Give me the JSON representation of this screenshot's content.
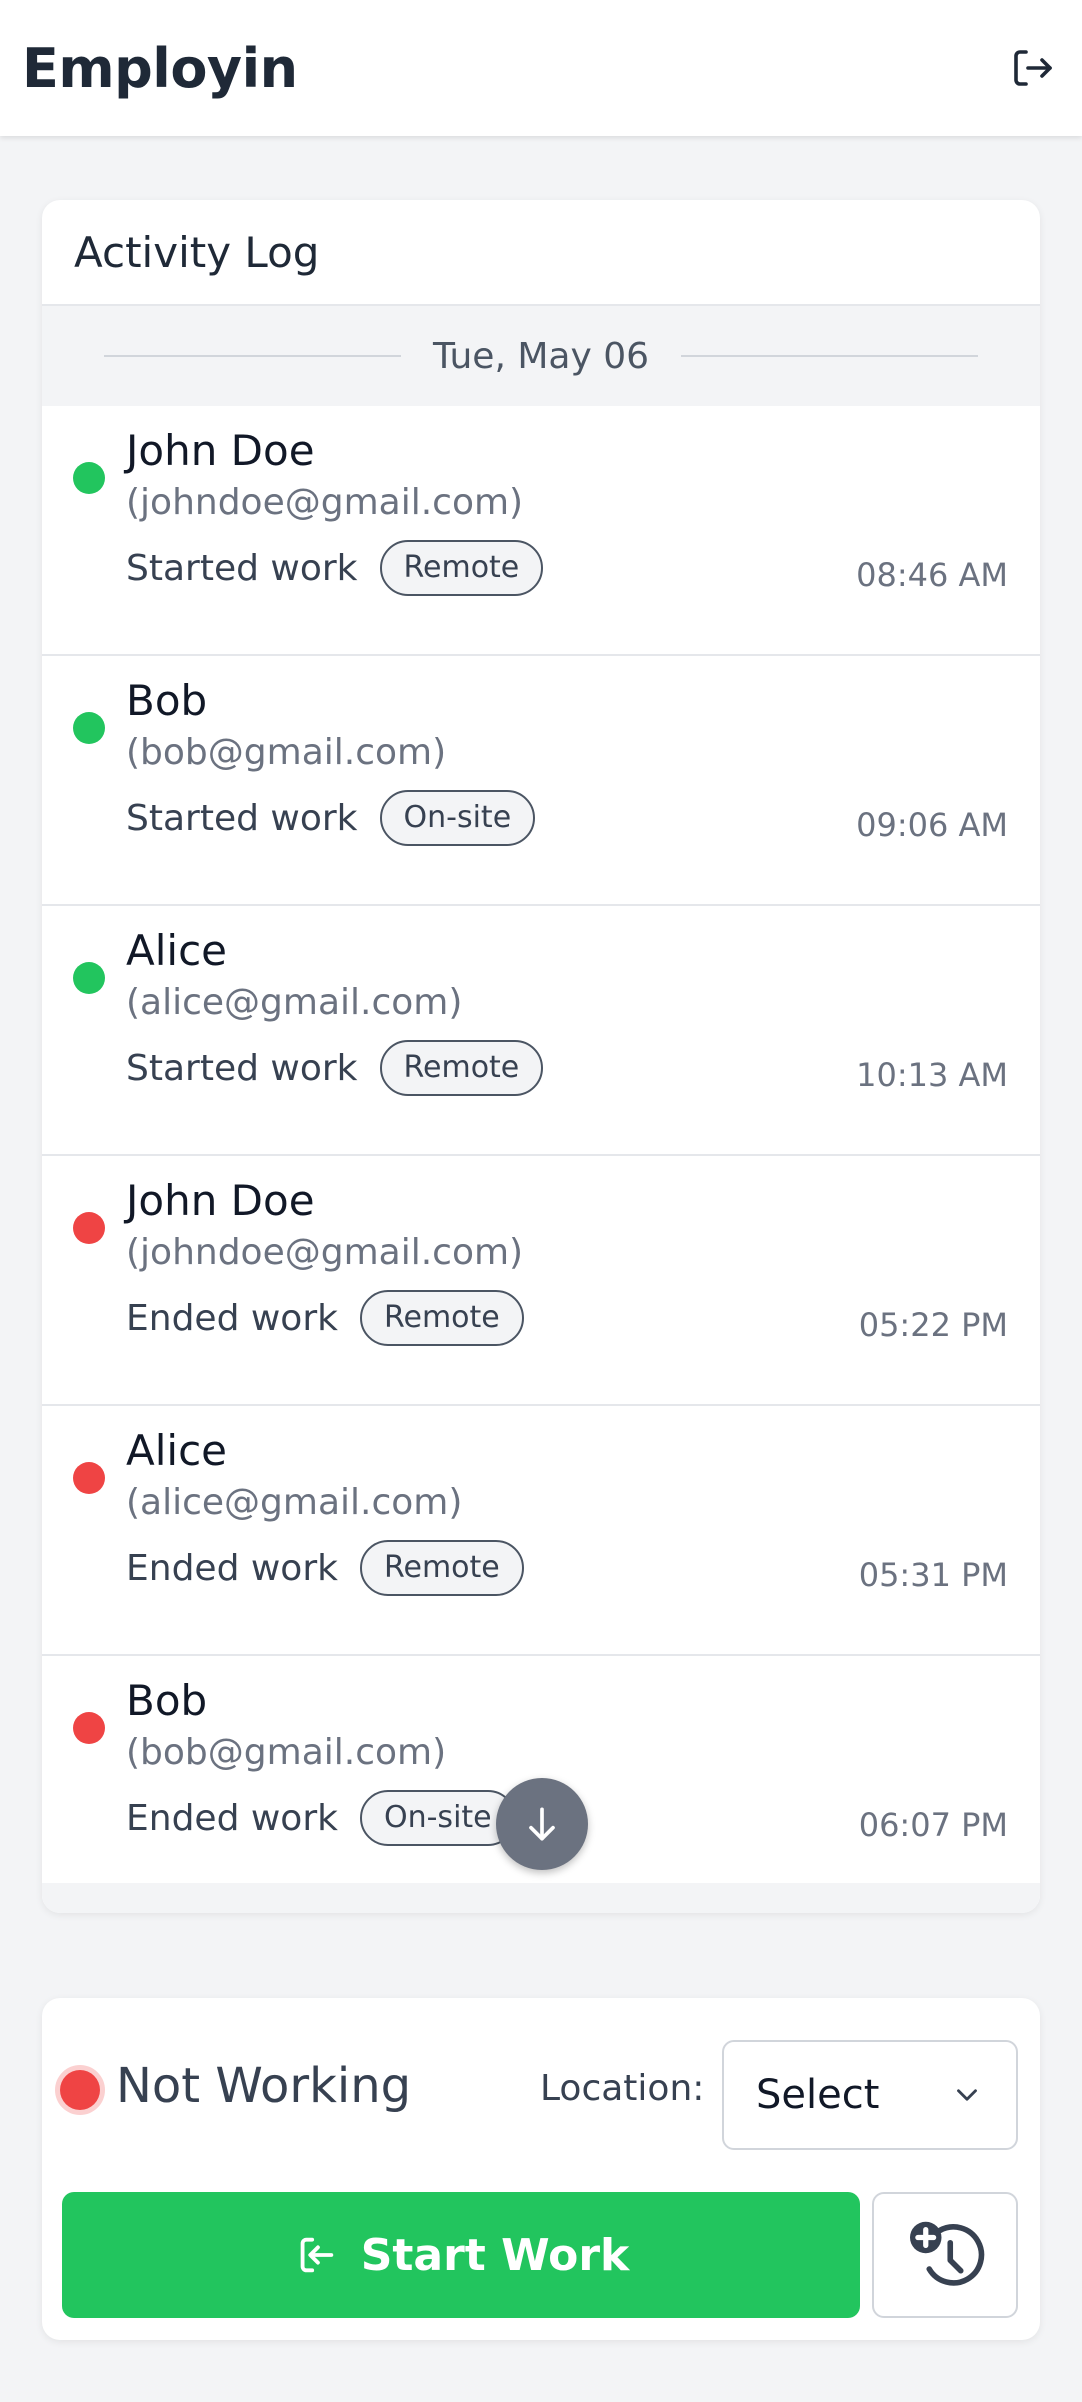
{
  "app": {
    "title": "Employin"
  },
  "header": {
    "logout_icon": "logout-icon"
  },
  "activity_log": {
    "title": "Activity Log",
    "date_label": "Tue, May 06",
    "entries": [
      {
        "name": "John Doe",
        "email": "(johndoe@gmail.com)",
        "action": "Started work",
        "location": "Remote",
        "time": "08:46 AM",
        "status": "started"
      },
      {
        "name": "Bob",
        "email": "(bob@gmail.com)",
        "action": "Started work",
        "location": "On-site",
        "time": "09:06 AM",
        "status": "started"
      },
      {
        "name": "Alice",
        "email": "(alice@gmail.com)",
        "action": "Started work",
        "location": "Remote",
        "time": "10:13 AM",
        "status": "started"
      },
      {
        "name": "John Doe",
        "email": "(johndoe@gmail.com)",
        "action": "Ended work",
        "location": "Remote",
        "time": "05:22 PM",
        "status": "ended"
      },
      {
        "name": "Alice",
        "email": "(alice@gmail.com)",
        "action": "Ended work",
        "location": "Remote",
        "time": "05:31 PM",
        "status": "ended"
      },
      {
        "name": "Bob",
        "email": "(bob@gmail.com)",
        "action": "Ended work",
        "location": "On-site",
        "time": "06:07 PM",
        "status": "ended"
      }
    ]
  },
  "controls": {
    "status_text": "Not Working",
    "location_label": "Location:",
    "location_value": "Select",
    "start_button_label": "Start Work",
    "start_icon": "login-icon",
    "history_icon": "history-add-icon"
  },
  "colors": {
    "started": "#22c55e",
    "ended": "#ef4444",
    "primary": "#22c55e",
    "scroll_button": "#6b7280"
  }
}
